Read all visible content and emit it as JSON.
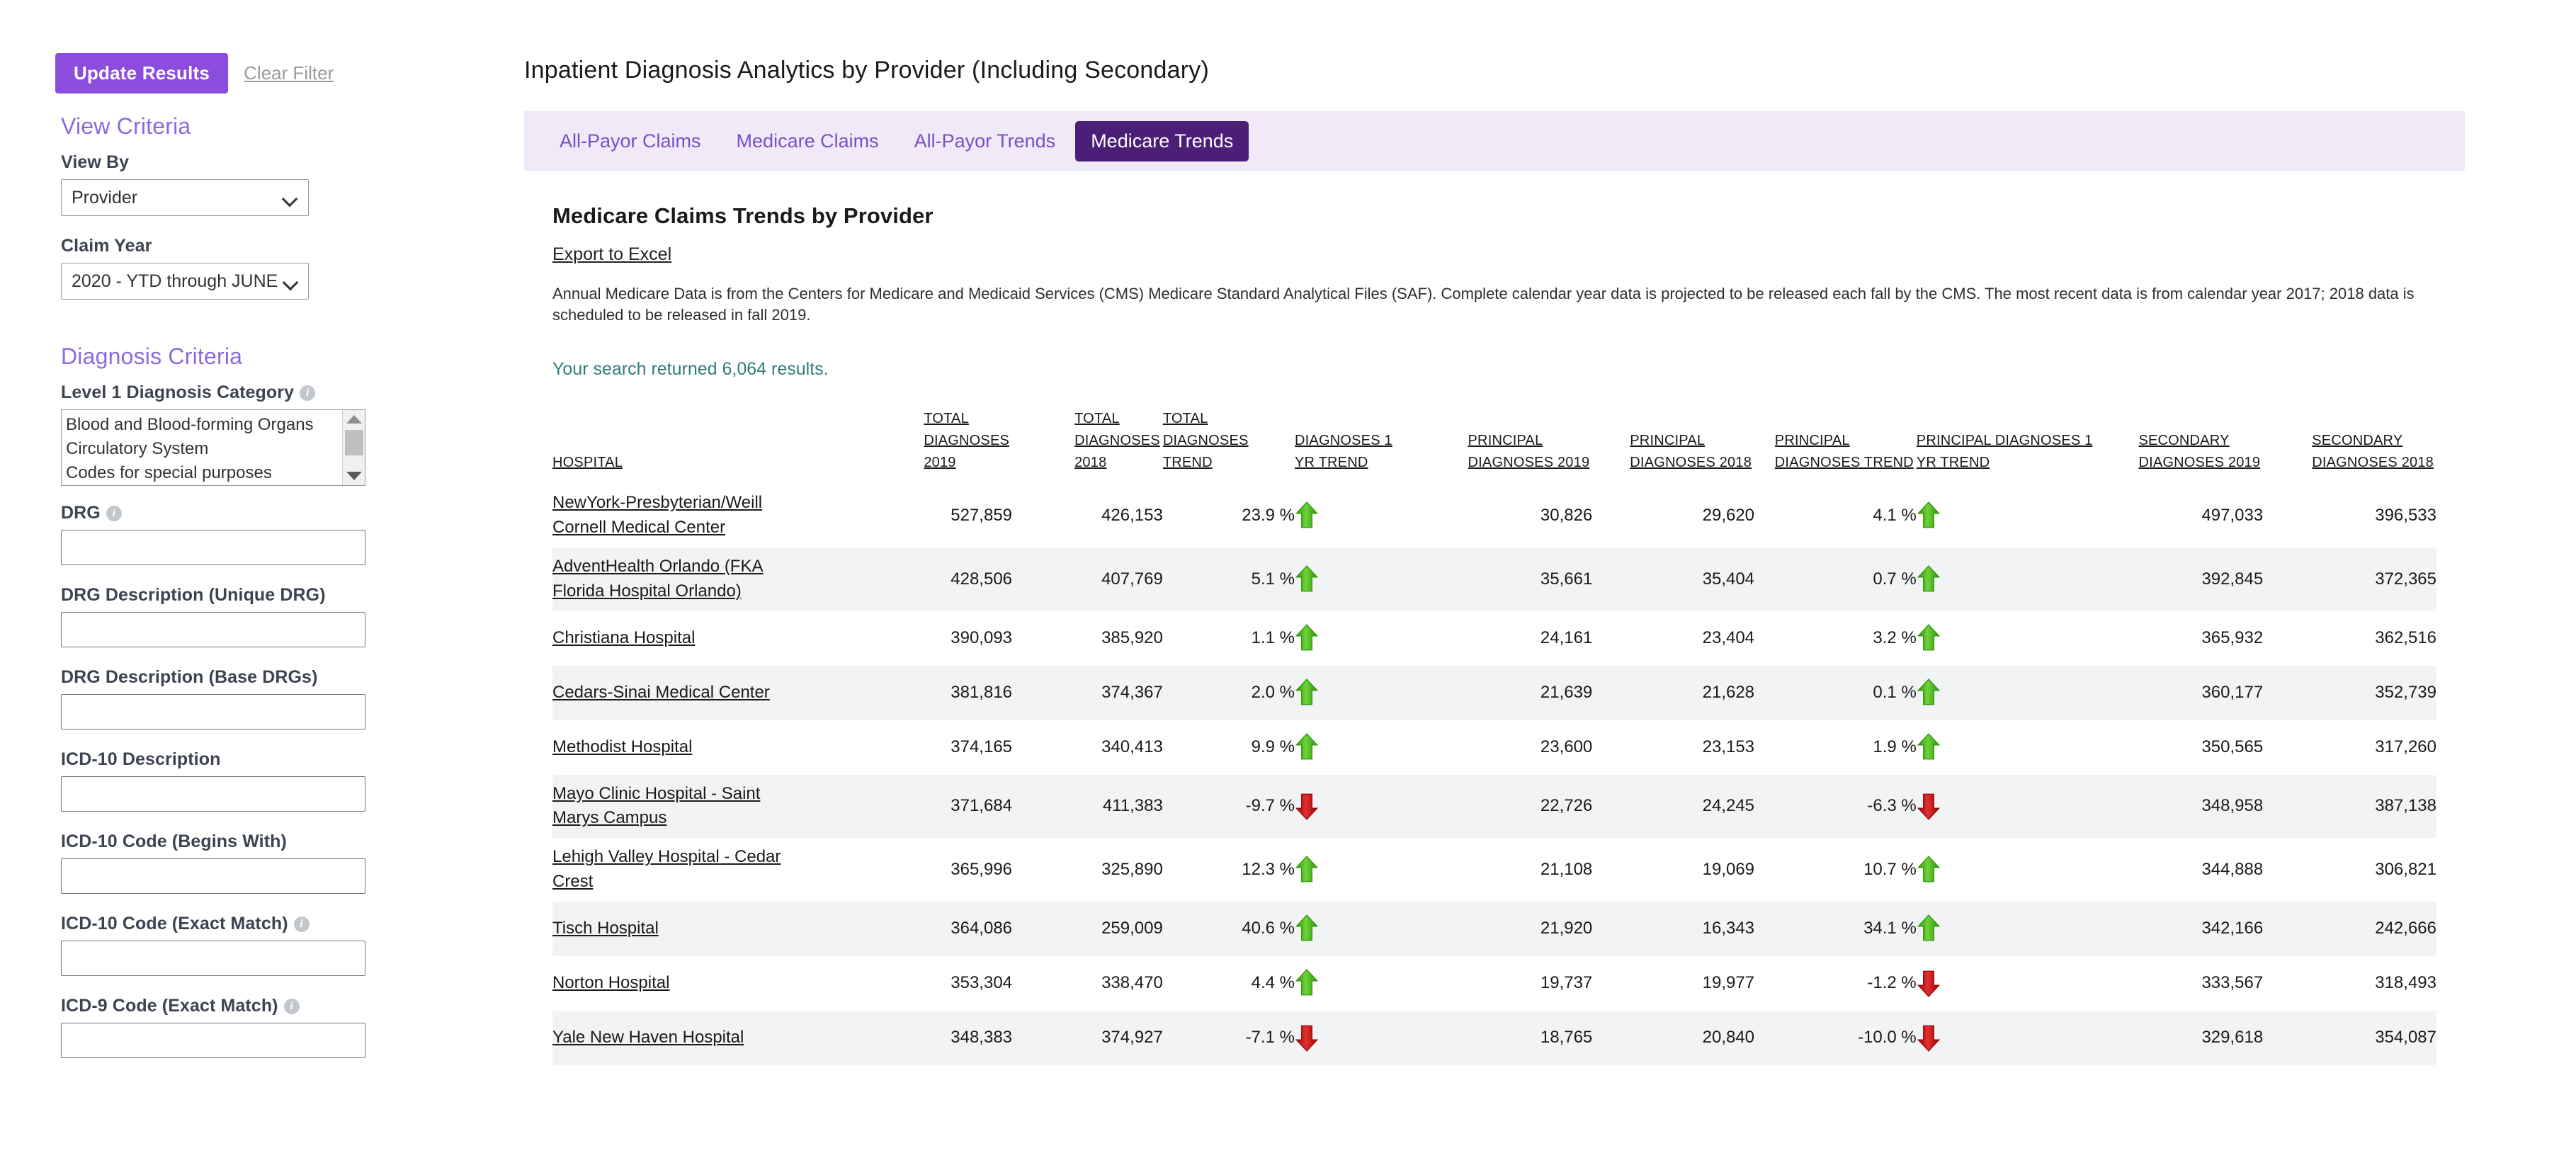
{
  "sidebar": {
    "update_button": "Update Results",
    "clear_filter": "Clear Filter",
    "view_criteria_heading": "View Criteria",
    "view_by_label": "View By",
    "view_by_value": "Provider",
    "claim_year_label": "Claim Year",
    "claim_year_value": "2020 - YTD through JUNE",
    "diagnosis_criteria_heading": "Diagnosis Criteria",
    "level1_label": "Level 1 Diagnosis Category",
    "level1_options": [
      "Blood and Blood-forming Organs",
      "Circulatory System",
      "Codes for special purposes"
    ],
    "fields": [
      {
        "label": "DRG",
        "value": "",
        "info": true
      },
      {
        "label": "DRG Description (Unique DRG)",
        "value": "",
        "info": false
      },
      {
        "label": "DRG Description (Base DRGs)",
        "value": "",
        "info": false
      },
      {
        "label": "ICD-10 Description",
        "value": "",
        "info": false
      },
      {
        "label": "ICD-10 Code (Begins With)",
        "value": "",
        "info": false
      },
      {
        "label": "ICD-10 Code (Exact Match)",
        "value": "",
        "info": true
      },
      {
        "label": "ICD-9 Code (Exact Match)",
        "value": "",
        "info": true
      }
    ]
  },
  "header": {
    "title": "Inpatient Diagnosis Analytics by Provider (Including Secondary)"
  },
  "tabs": [
    {
      "label": "All-Payor Claims",
      "active": false
    },
    {
      "label": "Medicare Claims",
      "active": false
    },
    {
      "label": "All-Payor Trends",
      "active": false
    },
    {
      "label": "Medicare Trends",
      "active": true
    }
  ],
  "content": {
    "title": "Medicare Claims Trends by Provider",
    "export_link": "Export to Excel",
    "disclaimer": "Annual Medicare Data is from the Centers for Medicare and Medicaid Services (CMS) Medicare Standard Analytical Files (SAF). Complete calendar year data is projected to be released each fall by the CMS. The most recent data is from calendar year 2017; 2018 data is scheduled to be released in fall 2019.",
    "results_count": "Your search returned 6,064 results."
  },
  "colors": {
    "accent_purple": "#8c4cdd",
    "tab_active": "#4b1f78",
    "tabbar_bg": "#f0eaf8",
    "trend_up": "#4caf1e",
    "trend_down": "#c01818",
    "results_text": "#2f7d7a"
  },
  "table": {
    "columns": [
      "HOSPITAL",
      "TOTAL DIAGNOSES 2019",
      "TOTAL DIAGNOSES 2018",
      "TOTAL DIAGNOSES TREND",
      "DIAGNOSES 1 YR TREND",
      "PRINCIPAL DIAGNOSES 2019",
      "PRINCIPAL DIAGNOSES 2018",
      "PRINCIPAL DIAGNOSES TREND",
      "PRINCIPAL DIAGNOSES 1 YR TREND",
      "SECONDARY DIAGNOSES 2019",
      "SECONDARY DIAGNOSES 2018"
    ],
    "column_lines": [
      [
        "HOSPITAL"
      ],
      [
        "TOTAL",
        "DIAGNOSES",
        "2019"
      ],
      [
        "TOTAL",
        "DIAGNOSES",
        "2018"
      ],
      [
        "TOTAL",
        "DIAGNOSES",
        "TREND"
      ],
      [
        "DIAGNOSES 1",
        "YR TREND"
      ],
      [
        "PRINCIPAL",
        "DIAGNOSES 2019"
      ],
      [
        "PRINCIPAL",
        "DIAGNOSES 2018"
      ],
      [
        "PRINCIPAL",
        "DIAGNOSES TREND"
      ],
      [
        "PRINCIPAL DIAGNOSES 1",
        "YR TREND"
      ],
      [
        "SECONDARY",
        "DIAGNOSES 2019"
      ],
      [
        "SECONDARY",
        "DIAGNOSES 2018"
      ]
    ],
    "rows": [
      {
        "hospital": "NewYork-Presbyterian/Weill Cornell Medical Center",
        "total_2019": "527,859",
        "total_2018": "426,153",
        "total_trend": "23.9 %",
        "total_trend_dir": "up",
        "principal_2019": "30,826",
        "principal_2018": "29,620",
        "principal_trend": "4.1 %",
        "principal_trend_dir": "up",
        "secondary_2019": "497,033",
        "secondary_2018": "396,533"
      },
      {
        "hospital": "AdventHealth Orlando (FKA Florida Hospital Orlando)",
        "total_2019": "428,506",
        "total_2018": "407,769",
        "total_trend": "5.1 %",
        "total_trend_dir": "up",
        "principal_2019": "35,661",
        "principal_2018": "35,404",
        "principal_trend": "0.7 %",
        "principal_trend_dir": "up",
        "secondary_2019": "392,845",
        "secondary_2018": "372,365"
      },
      {
        "hospital": "Christiana Hospital",
        "total_2019": "390,093",
        "total_2018": "385,920",
        "total_trend": "1.1 %",
        "total_trend_dir": "up",
        "principal_2019": "24,161",
        "principal_2018": "23,404",
        "principal_trend": "3.2 %",
        "principal_trend_dir": "up",
        "secondary_2019": "365,932",
        "secondary_2018": "362,516"
      },
      {
        "hospital": "Cedars-Sinai Medical Center",
        "total_2019": "381,816",
        "total_2018": "374,367",
        "total_trend": "2.0 %",
        "total_trend_dir": "up",
        "principal_2019": "21,639",
        "principal_2018": "21,628",
        "principal_trend": "0.1 %",
        "principal_trend_dir": "up",
        "secondary_2019": "360,177",
        "secondary_2018": "352,739"
      },
      {
        "hospital": "Methodist Hospital",
        "total_2019": "374,165",
        "total_2018": "340,413",
        "total_trend": "9.9 %",
        "total_trend_dir": "up",
        "principal_2019": "23,600",
        "principal_2018": "23,153",
        "principal_trend": "1.9 %",
        "principal_trend_dir": "up",
        "secondary_2019": "350,565",
        "secondary_2018": "317,260"
      },
      {
        "hospital": "Mayo Clinic Hospital - Saint Marys Campus",
        "total_2019": "371,684",
        "total_2018": "411,383",
        "total_trend": "-9.7 %",
        "total_trend_dir": "down",
        "principal_2019": "22,726",
        "principal_2018": "24,245",
        "principal_trend": "-6.3 %",
        "principal_trend_dir": "down",
        "secondary_2019": "348,958",
        "secondary_2018": "387,138"
      },
      {
        "hospital": "Lehigh Valley Hospital - Cedar Crest",
        "total_2019": "365,996",
        "total_2018": "325,890",
        "total_trend": "12.3 %",
        "total_trend_dir": "up",
        "principal_2019": "21,108",
        "principal_2018": "19,069",
        "principal_trend": "10.7 %",
        "principal_trend_dir": "up",
        "secondary_2019": "344,888",
        "secondary_2018": "306,821"
      },
      {
        "hospital": "Tisch Hospital",
        "total_2019": "364,086",
        "total_2018": "259,009",
        "total_trend": "40.6 %",
        "total_trend_dir": "up",
        "principal_2019": "21,920",
        "principal_2018": "16,343",
        "principal_trend": "34.1 %",
        "principal_trend_dir": "up",
        "secondary_2019": "342,166",
        "secondary_2018": "242,666"
      },
      {
        "hospital": "Norton Hospital",
        "total_2019": "353,304",
        "total_2018": "338,470",
        "total_trend": "4.4 %",
        "total_trend_dir": "up",
        "principal_2019": "19,737",
        "principal_2018": "19,977",
        "principal_trend": "-1.2 %",
        "principal_trend_dir": "down",
        "secondary_2019": "333,567",
        "secondary_2018": "318,493"
      },
      {
        "hospital": "Yale New Haven Hospital",
        "total_2019": "348,383",
        "total_2018": "374,927",
        "total_trend": "-7.1 %",
        "total_trend_dir": "down",
        "principal_2019": "18,765",
        "principal_2018": "20,840",
        "principal_trend": "-10.0 %",
        "principal_trend_dir": "down",
        "secondary_2019": "329,618",
        "secondary_2018": "354,087"
      }
    ]
  }
}
